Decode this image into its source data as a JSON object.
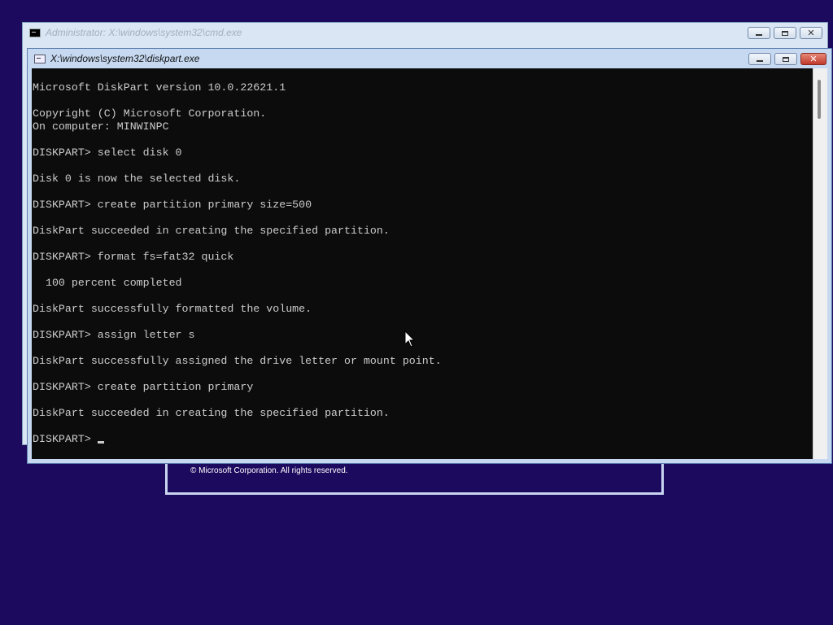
{
  "background_window": {
    "title": "Administrator: X:\\windows\\system32\\cmd.exe"
  },
  "front_window": {
    "title": "X:\\windows\\system32\\diskpart.exe",
    "controls": {
      "minimize": "minimize",
      "maximize": "maximize",
      "close": "close"
    }
  },
  "console": {
    "lines": [
      "Microsoft DiskPart version 10.0.22621.1",
      "",
      "Copyright (C) Microsoft Corporation.",
      "On computer: MINWINPC",
      "",
      "DISKPART> select disk 0",
      "",
      "Disk 0 is now the selected disk.",
      "",
      "DISKPART> create partition primary size=500",
      "",
      "DiskPart succeeded in creating the specified partition.",
      "",
      "DISKPART> format fs=fat32 quick",
      "",
      "  100 percent completed",
      "",
      "DiskPart successfully formatted the volume.",
      "",
      "DISKPART> assign letter s",
      "",
      "DiskPart successfully assigned the drive letter or mount point.",
      "",
      "DISKPART> create partition primary",
      "",
      "DiskPart succeeded in creating the specified partition.",
      ""
    ],
    "prompt": "DISKPART> "
  },
  "setup_dialog": {
    "copyright": "© Microsoft Corporation. All rights reserved."
  },
  "colors": {
    "desktop": "#1c0a5e",
    "console_bg": "#0c0c0c",
    "console_fg": "#cccccc"
  },
  "icons": {
    "window_icon": "cmd-icon",
    "pointer": "mouse-pointer-icon"
  }
}
